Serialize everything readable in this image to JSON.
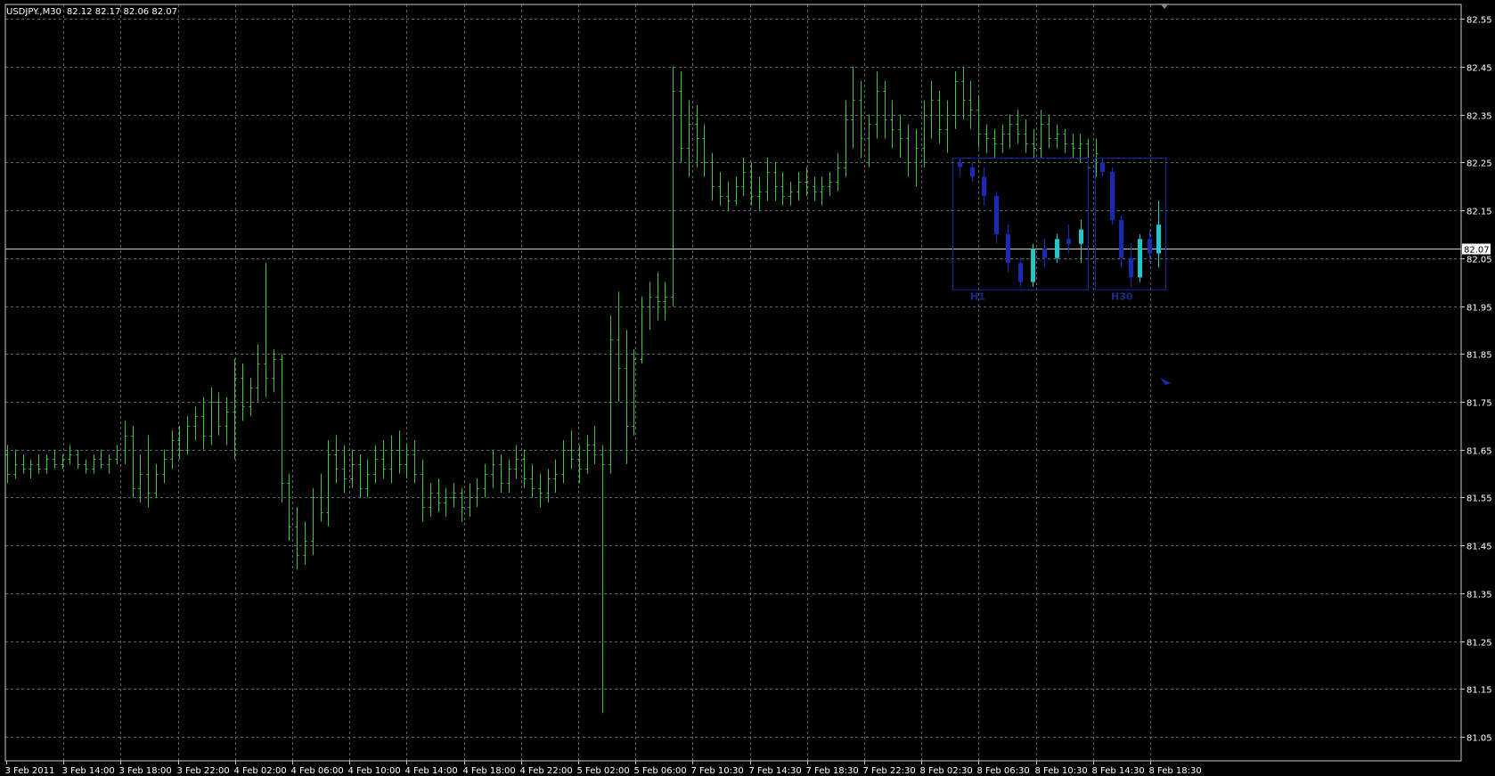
{
  "header": {
    "symbol": "USDJPY.,M30",
    "ohlc": "82.12 82.17 82.06 82.07"
  },
  "colors": {
    "background": "#000000",
    "grid": "#5a6670",
    "frame": "#c8c8c8",
    "bars": "#3fbf3f",
    "bid_line": "#c8c8c8",
    "overlay_frame": "#1428a0",
    "overlay_bull": "#20c8c8",
    "overlay_bear": "#1a2ab4",
    "price_tag_bg": "#ffffff"
  },
  "chart_data": {
    "type": "ohlc",
    "instrument": "USDJPY",
    "timeframe": "M30",
    "ylim": [
      81.0,
      82.58
    ],
    "grid": true,
    "y_ticks": [
      "82.55",
      "82.45",
      "82.35",
      "82.25",
      "82.15",
      "82.05",
      "81.95",
      "81.85",
      "81.75",
      "81.65",
      "81.55",
      "81.45",
      "81.35",
      "81.25",
      "81.15",
      "81.05"
    ],
    "x_ticks": [
      "3 Feb 2011",
      "3 Feb 14:00",
      "3 Feb 18:00",
      "3 Feb 22:00",
      "4 Feb 02:00",
      "4 Feb 06:00",
      "4 Feb 10:00",
      "4 Feb 14:00",
      "4 Feb 18:00",
      "4 Feb 22:00",
      "5 Feb 02:00",
      "5 Feb 06:00",
      "7 Feb 10:30",
      "7 Feb 14:30",
      "7 Feb 18:30",
      "7 Feb 22:30",
      "8 Feb 02:30",
      "8 Feb 06:30",
      "8 Feb 10:30",
      "8 Feb 14:30",
      "8 Feb 18:30"
    ],
    "current_price": "82.07",
    "series": [
      {
        "values": [
          [
            81.64,
            81.66,
            81.58,
            81.6
          ],
          [
            81.6,
            81.65,
            81.59,
            81.62
          ],
          [
            81.62,
            81.64,
            81.6,
            81.61
          ],
          [
            81.61,
            81.63,
            81.59,
            81.62
          ],
          [
            81.62,
            81.64,
            81.6,
            81.61
          ],
          [
            81.61,
            81.64,
            81.6,
            81.63
          ],
          [
            81.63,
            81.65,
            81.61,
            81.62
          ],
          [
            81.62,
            81.64,
            81.61,
            81.63
          ],
          [
            81.63,
            81.66,
            81.62,
            81.64
          ],
          [
            81.64,
            81.65,
            81.61,
            81.62
          ],
          [
            81.62,
            81.63,
            81.6,
            81.61
          ],
          [
            81.61,
            81.64,
            81.6,
            81.63
          ],
          [
            81.63,
            81.65,
            81.61,
            81.62
          ],
          [
            81.62,
            81.64,
            81.6,
            81.63
          ],
          [
            81.63,
            81.66,
            81.62,
            81.65
          ],
          [
            81.65,
            81.71,
            81.62,
            81.68
          ],
          [
            81.68,
            81.7,
            81.55,
            81.57
          ],
          [
            81.57,
            81.64,
            81.54,
            81.6
          ],
          [
            81.6,
            81.68,
            81.53,
            81.56
          ],
          [
            81.56,
            81.62,
            81.55,
            81.6
          ],
          [
            81.6,
            81.65,
            81.58,
            81.63
          ],
          [
            81.63,
            81.69,
            81.61,
            81.67
          ],
          [
            81.67,
            81.7,
            81.63,
            81.65
          ],
          [
            81.65,
            81.72,
            81.64,
            81.7
          ],
          [
            81.7,
            81.74,
            81.67,
            81.72
          ],
          [
            81.72,
            81.76,
            81.65,
            81.68
          ],
          [
            81.68,
            81.78,
            81.66,
            81.75
          ],
          [
            81.75,
            81.77,
            81.68,
            81.7
          ],
          [
            81.7,
            81.76,
            81.66,
            81.73
          ],
          [
            81.73,
            81.84,
            81.63,
            81.8
          ],
          [
            81.8,
            81.83,
            81.71,
            81.74
          ],
          [
            81.74,
            81.8,
            81.72,
            81.78
          ],
          [
            81.78,
            81.87,
            81.75,
            81.83
          ],
          [
            81.83,
            82.04,
            81.76,
            81.8
          ],
          [
            81.8,
            81.86,
            81.77,
            81.84
          ],
          [
            81.84,
            81.85,
            81.54,
            81.58
          ],
          [
            81.58,
            81.6,
            81.46,
            81.49
          ],
          [
            81.49,
            81.53,
            81.4,
            81.43
          ],
          [
            81.43,
            81.5,
            81.41,
            81.46
          ],
          [
            81.46,
            81.57,
            81.43,
            81.55
          ],
          [
            81.55,
            81.6,
            81.5,
            81.52
          ],
          [
            81.52,
            81.67,
            81.49,
            81.64
          ],
          [
            81.64,
            81.68,
            81.58,
            81.61
          ],
          [
            81.61,
            81.66,
            81.56,
            81.59
          ],
          [
            81.59,
            81.65,
            81.57,
            81.62
          ],
          [
            81.62,
            81.64,
            81.55,
            81.57
          ],
          [
            81.57,
            81.63,
            81.55,
            81.6
          ],
          [
            81.6,
            81.66,
            81.58,
            81.63
          ],
          [
            81.63,
            81.67,
            81.59,
            81.61
          ],
          [
            81.61,
            81.68,
            81.58,
            81.65
          ],
          [
            81.65,
            81.69,
            81.6,
            81.62
          ],
          [
            81.62,
            81.66,
            81.59,
            81.64
          ],
          [
            81.64,
            81.67,
            81.58,
            81.6
          ],
          [
            81.6,
            81.63,
            81.5,
            81.53
          ],
          [
            81.53,
            81.58,
            81.51,
            81.56
          ],
          [
            81.56,
            81.59,
            81.52,
            81.54
          ],
          [
            81.54,
            81.57,
            81.51,
            81.55
          ],
          [
            81.55,
            81.58,
            81.53,
            81.56
          ],
          [
            81.56,
            81.57,
            81.5,
            81.53
          ],
          [
            81.53,
            81.58,
            81.51,
            81.55
          ],
          [
            81.55,
            81.59,
            81.53,
            81.57
          ],
          [
            81.57,
            81.62,
            81.55,
            81.6
          ],
          [
            81.6,
            81.65,
            81.57,
            81.62
          ],
          [
            81.62,
            81.64,
            81.56,
            81.58
          ],
          [
            81.58,
            81.63,
            81.56,
            81.61
          ],
          [
            81.61,
            81.66,
            81.59,
            81.63
          ],
          [
            81.63,
            81.65,
            81.57,
            81.59
          ],
          [
            81.59,
            81.62,
            81.55,
            81.57
          ],
          [
            81.57,
            81.6,
            81.53,
            81.56
          ],
          [
            81.56,
            81.61,
            81.54,
            81.59
          ],
          [
            81.59,
            81.63,
            81.56,
            81.6
          ],
          [
            81.6,
            81.67,
            81.58,
            81.65
          ],
          [
            81.65,
            81.69,
            81.61,
            81.63
          ],
          [
            81.63,
            81.66,
            81.58,
            81.61
          ],
          [
            81.61,
            81.68,
            81.6,
            81.66
          ],
          [
            81.66,
            81.7,
            81.62,
            81.64
          ],
          [
            81.64,
            81.66,
            81.1,
            81.62
          ],
          [
            81.62,
            81.93,
            81.6,
            81.88
          ],
          [
            81.88,
            81.98,
            81.75,
            81.82
          ],
          [
            81.82,
            81.9,
            81.62,
            81.7
          ],
          [
            81.7,
            81.86,
            81.68,
            81.84
          ],
          [
            81.84,
            81.97,
            81.83,
            81.95
          ],
          [
            81.95,
            82.0,
            81.9,
            81.97
          ],
          [
            81.97,
            82.02,
            81.92,
            81.96
          ],
          [
            81.96,
            82.0,
            81.92,
            81.97
          ],
          [
            81.97,
            82.45,
            81.95,
            82.4
          ],
          [
            82.4,
            82.44,
            82.25,
            82.28
          ],
          [
            82.28,
            82.38,
            82.22,
            82.33
          ],
          [
            82.33,
            82.37,
            82.24,
            82.3
          ],
          [
            82.3,
            82.33,
            82.22,
            82.25
          ],
          [
            82.25,
            82.27,
            82.17,
            82.2
          ],
          [
            82.2,
            82.23,
            82.16,
            82.18
          ],
          [
            82.18,
            82.21,
            82.15,
            82.17
          ],
          [
            82.17,
            82.22,
            82.16,
            82.2
          ],
          [
            82.2,
            82.26,
            82.18,
            82.23
          ],
          [
            82.23,
            82.25,
            82.16,
            82.18
          ],
          [
            82.18,
            82.22,
            82.15,
            82.19
          ],
          [
            82.19,
            82.26,
            82.17,
            82.23
          ],
          [
            82.23,
            82.25,
            82.17,
            82.2
          ],
          [
            82.2,
            82.23,
            82.16,
            82.18
          ],
          [
            82.18,
            82.21,
            82.16,
            82.19
          ],
          [
            82.19,
            82.23,
            82.17,
            82.21
          ],
          [
            82.21,
            82.24,
            82.18,
            82.2
          ],
          [
            82.2,
            82.22,
            82.17,
            82.19
          ],
          [
            82.19,
            82.22,
            82.16,
            82.2
          ],
          [
            82.2,
            82.23,
            82.18,
            82.21
          ],
          [
            82.21,
            82.27,
            82.19,
            82.24
          ],
          [
            82.24,
            82.38,
            82.22,
            82.34
          ],
          [
            82.34,
            82.45,
            82.28,
            82.38
          ],
          [
            82.38,
            82.42,
            82.26,
            82.3
          ],
          [
            82.3,
            82.35,
            82.24,
            82.33
          ],
          [
            82.33,
            82.44,
            82.3,
            82.4
          ],
          [
            82.4,
            82.42,
            82.3,
            82.34
          ],
          [
            82.34,
            82.38,
            82.28,
            82.32
          ],
          [
            82.32,
            82.35,
            82.26,
            82.3
          ],
          [
            82.3,
            82.33,
            82.22,
            82.25
          ],
          [
            82.25,
            82.32,
            82.2,
            82.28
          ],
          [
            82.28,
            82.38,
            82.24,
            82.35
          ],
          [
            82.35,
            82.42,
            82.3,
            82.38
          ],
          [
            82.38,
            82.4,
            82.29,
            82.32
          ],
          [
            82.32,
            82.38,
            82.27,
            82.35
          ],
          [
            82.35,
            82.44,
            82.32,
            82.42
          ],
          [
            82.42,
            82.45,
            82.34,
            82.38
          ],
          [
            82.38,
            82.42,
            82.32,
            82.36
          ],
          [
            82.36,
            82.39,
            82.28,
            82.31
          ],
          [
            82.31,
            82.33,
            82.27,
            82.3
          ],
          [
            82.3,
            82.32,
            82.26,
            82.29
          ],
          [
            82.29,
            82.33,
            82.27,
            82.31
          ],
          [
            82.31,
            82.35,
            82.28,
            82.33
          ],
          [
            82.33,
            82.36,
            82.29,
            82.31
          ],
          [
            82.31,
            82.34,
            82.27,
            82.29
          ],
          [
            82.29,
            82.32,
            82.26,
            82.28
          ],
          [
            82.28,
            82.36,
            82.26,
            82.33
          ],
          [
            82.33,
            82.35,
            82.28,
            82.3
          ],
          [
            82.3,
            82.33,
            82.28,
            82.31
          ],
          [
            82.31,
            82.32,
            82.27,
            82.29
          ],
          [
            82.29,
            82.31,
            82.26,
            82.28
          ],
          [
            82.28,
            82.31,
            82.25,
            82.29
          ],
          [
            82.29,
            82.3,
            82.19,
            82.24
          ],
          [
            82.24,
            82.3,
            82.22,
            82.27
          ]
        ]
      }
    ],
    "overlays": [
      {
        "label": "H1",
        "bars": [
          [
            82.25,
            82.26,
            82.22,
            82.24
          ],
          [
            82.24,
            82.25,
            82.21,
            82.22
          ],
          [
            82.22,
            82.24,
            82.16,
            82.18
          ],
          [
            82.18,
            82.19,
            82.08,
            82.1
          ],
          [
            82.1,
            82.12,
            82.02,
            82.04
          ],
          [
            82.04,
            82.05,
            81.99,
            82.0
          ],
          [
            82.0,
            82.08,
            81.99,
            82.07
          ],
          [
            82.07,
            82.09,
            82.03,
            82.05
          ],
          [
            82.05,
            82.1,
            82.04,
            82.09
          ],
          [
            82.09,
            82.12,
            82.06,
            82.08
          ],
          [
            82.08,
            82.13,
            82.04,
            82.11
          ]
        ]
      },
      {
        "label": "H30",
        "bars": [
          [
            82.25,
            82.26,
            82.22,
            82.23
          ],
          [
            82.23,
            82.24,
            82.12,
            82.13
          ],
          [
            82.13,
            82.14,
            82.03,
            82.05
          ],
          [
            82.05,
            82.08,
            81.99,
            82.01
          ],
          [
            82.01,
            82.1,
            82.0,
            82.09
          ],
          [
            82.09,
            82.11,
            82.04,
            82.06
          ],
          [
            82.06,
            82.17,
            82.03,
            82.12
          ]
        ]
      }
    ]
  }
}
